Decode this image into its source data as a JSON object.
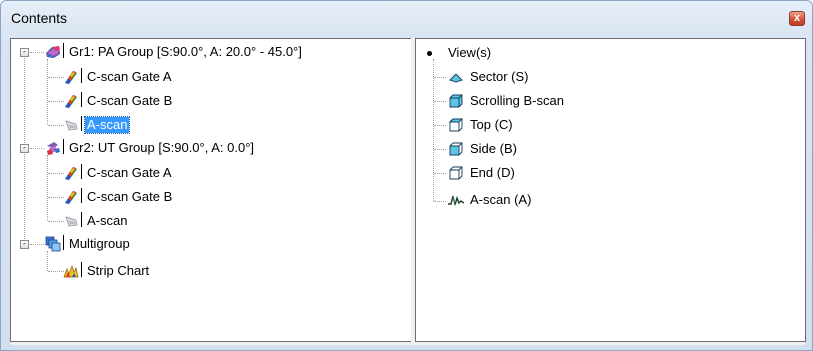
{
  "window": {
    "title": "Contents",
    "close_symbol": "x"
  },
  "left_tree": {
    "groups": [
      {
        "label": "Gr1: PA Group [S:90.0°, A: 20.0° - 45.0°]",
        "icon": "pa-group-icon",
        "expander": "-",
        "children": [
          {
            "label": "C-scan Gate A",
            "icon": "cscan-icon"
          },
          {
            "label": "C-scan Gate B",
            "icon": "cscan-icon"
          },
          {
            "label": "A-scan",
            "icon": "ascan-icon",
            "selected": true
          }
        ]
      },
      {
        "label": "Gr2: UT Group [S:90.0°, A: 0.0°]",
        "icon": "ut-group-icon",
        "expander": "-",
        "children": [
          {
            "label": "C-scan Gate A",
            "icon": "cscan-icon"
          },
          {
            "label": "C-scan Gate B",
            "icon": "cscan-icon"
          },
          {
            "label": "A-scan",
            "icon": "ascan-icon"
          }
        ]
      },
      {
        "label": "Multigroup",
        "icon": "multigroup-icon",
        "expander": "-",
        "children": [
          {
            "label": "Strip Chart",
            "icon": "strip-chart-icon"
          }
        ]
      }
    ]
  },
  "right_tree": {
    "root_label": "View(s)",
    "items": [
      {
        "label": "Sector (S)",
        "icon": "sector-view-icon"
      },
      {
        "label": "Scrolling B-scan",
        "icon": "cube-icon"
      },
      {
        "label": "Top (C)",
        "icon": "cube-icon"
      },
      {
        "label": "Side (B)",
        "icon": "cube-icon"
      },
      {
        "label": "End (D)",
        "icon": "cube-icon"
      },
      {
        "label": "A-scan (A)",
        "icon": "waveform-icon"
      }
    ]
  }
}
